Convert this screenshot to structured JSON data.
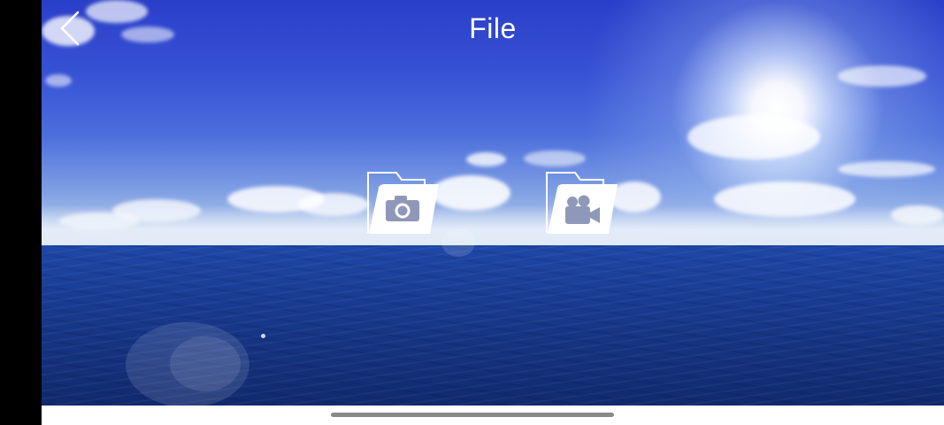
{
  "header": {
    "title": "File",
    "back_icon": "chevron-left-icon"
  },
  "folders": [
    {
      "name": "photo",
      "icon": "camera-folder-icon"
    },
    {
      "name": "video",
      "icon": "video-camera-folder-icon"
    }
  ],
  "colors": {
    "title_text": "#ffffff",
    "icon": "#ffffff",
    "sky_top": "#2a3fc9",
    "sea": "#163585"
  }
}
